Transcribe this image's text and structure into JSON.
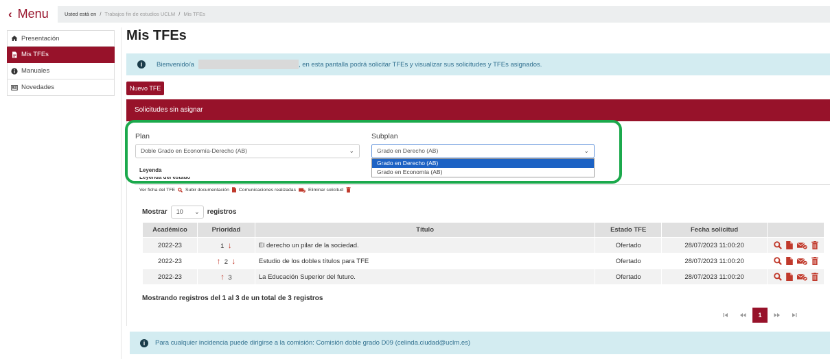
{
  "topbar": {
    "menu_label": "Menu",
    "breadcrumb": {
      "prefix": "Usted está en",
      "link": "Trabajos fin de estudios UCLM",
      "current": "Mis TFEs"
    }
  },
  "sidebar": {
    "items": [
      {
        "label": "Presentación",
        "icon": "home-icon",
        "active": false
      },
      {
        "label": "Mis TFEs",
        "icon": "document-icon",
        "active": true
      },
      {
        "label": "Manuales",
        "icon": "info-icon",
        "active": false
      },
      {
        "label": "Novedades",
        "icon": "newspaper-icon",
        "active": false
      }
    ]
  },
  "page": {
    "title": "Mis TFEs",
    "welcome_prefix": "Bienvenido/a",
    "welcome_suffix": ", en esta pantalla podrá solicitar TFEs y visualizar sus solicitudes y TFEs asignados.",
    "new_button": "Nuevo TFE"
  },
  "panel": {
    "title": "Solicitudes sin asignar",
    "plan_label": "Plan",
    "plan_value": "Doble Grado en Economía-Derecho (AB)",
    "subplan_label": "Subplan",
    "subplan_value": "Grado en Derecho (AB)",
    "subplan_options": [
      "Grado en Derecho (AB)",
      "Grado en Economía (AB)"
    ],
    "legend_title": "Leyenda",
    "legend_cut": "Leyenda del estado",
    "legend": {
      "ver_ficha": "Ver ficha del TFE",
      "subir": "Subir documentación",
      "comunicaciones": "Comunicaciones realizadas",
      "eliminar": "Eliminar solicitud"
    },
    "length_prefix": "Mostrar",
    "length_value": "10",
    "length_suffix": "registros"
  },
  "table": {
    "headers": [
      "Académico",
      "Prioridad",
      "Título",
      "Estado TFE",
      "Fecha solicitud",
      ""
    ],
    "rows": [
      {
        "academico": "2022-23",
        "prioridad": "1",
        "up": false,
        "down": true,
        "titulo": "El derecho un pilar de la sociedad.",
        "estado": "Ofertado",
        "fecha": "28/07/2023 11:00:20"
      },
      {
        "academico": "2022-23",
        "prioridad": "2",
        "up": true,
        "down": true,
        "titulo": "Estudio de los dobles títulos para TFE",
        "estado": "Ofertado",
        "fecha": "28/07/2023 11:00:20"
      },
      {
        "academico": "2022-23",
        "prioridad": "3",
        "up": true,
        "down": false,
        "titulo": "La Educación Superior del futuro.",
        "estado": "Ofertado",
        "fecha": "28/07/2023 11:00:20"
      }
    ],
    "info": "Mostrando registros del 1 al 3 de un total de 3 registros",
    "pager": {
      "first": "⏮",
      "prev": "⏪",
      "current": "1",
      "next": "⏩",
      "last": "⏭"
    }
  },
  "footer": {
    "text": "Para cualquier incidencia puede dirigirse a la comisión: Comisión doble grado D09 (celinda.ciudad@uclm.es)"
  },
  "colors": {
    "brand": "#97122a",
    "info_bg": "#d3ecf1",
    "highlight": "#1ba94c",
    "icon_red": "#c0392b"
  }
}
